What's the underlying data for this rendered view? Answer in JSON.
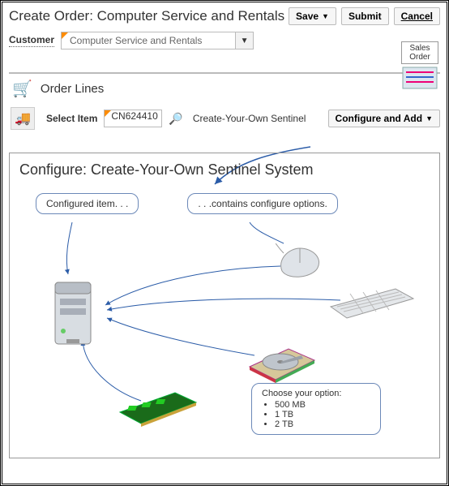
{
  "header": {
    "title": "Create Order: Computer Service and Rentals",
    "save_label": "Save",
    "submit_label": "Submit",
    "cancel_label": "Cancel"
  },
  "customer": {
    "label": "Customer",
    "value": "Computer Service and Rentals"
  },
  "sales_badge": {
    "line1": "Sales",
    "line2": "Order"
  },
  "order_lines": {
    "heading": "Order Lines",
    "select_item_label": "Select Item",
    "item_code": "CN624410",
    "item_name": "Create-Your-Own Sentinel",
    "configure_add_label": "Configure and Add"
  },
  "configure": {
    "title": "Configure: Create-Your-Own Sentinel System",
    "callout_left": "Configured  item. . .",
    "callout_right": ". . .contains configure  options.",
    "options_title": "Choose your option:",
    "options": [
      "500 MB",
      "1 TB",
      "2 TB"
    ]
  }
}
